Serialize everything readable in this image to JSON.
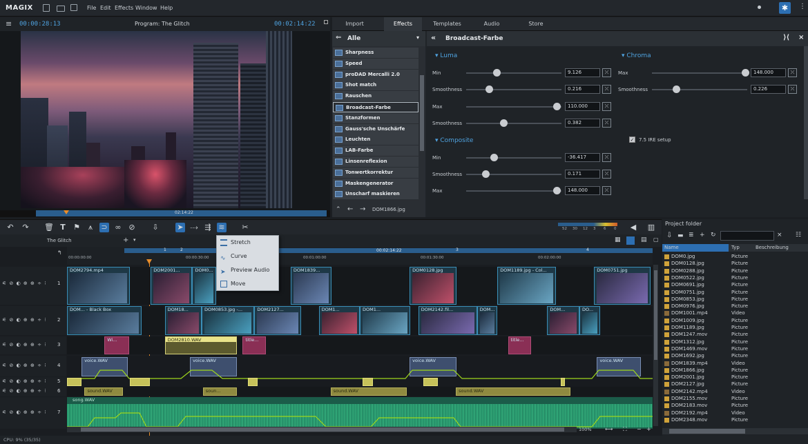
{
  "app": {
    "logo": "MAGIX",
    "menu": [
      "File",
      "Edit",
      "Effects",
      "Window",
      "Help"
    ]
  },
  "preview": {
    "timecode_left": "00:00:28:13",
    "title": "Program: The Glitch",
    "timecode_right": "00:02:14:22",
    "scrub_time": "02:14:22"
  },
  "tabs": [
    "Import",
    "Effects",
    "Templates",
    "Audio",
    "Store"
  ],
  "active_tab": "Effects",
  "fx": {
    "filter_label": "Alle",
    "items": [
      "Sharpness",
      "Speed",
      "proDAD Mercalli 2.0",
      "Shot match",
      "Rauschen",
      "Broadcast-Farbe",
      "Stanzformen",
      "Gauss'sche Unschärfe",
      "Leuchten",
      "LAB-Farbe",
      "Linsenreflexion",
      "Tonwertkorrektur",
      "Maskengenerator",
      "Unscharf maskieren"
    ],
    "selected": "Broadcast-Farbe",
    "footer_file": "DOM1866.jpg"
  },
  "params": {
    "title": "Broadcast-Farbe",
    "luma": {
      "label": "Luma",
      "rows": [
        {
          "name": "Min",
          "value": "9.126",
          "level": 0.32
        },
        {
          "name": "Smoothness",
          "value": "0.216",
          "level": 0.24
        },
        {
          "name": "Max",
          "value": "110.000",
          "level": 0.95
        },
        {
          "name": "Smoothness",
          "value": "0.382",
          "level": 0.39
        }
      ]
    },
    "composite": {
      "label": "Composite",
      "rows": [
        {
          "name": "Min",
          "value": "-36.417",
          "level": 0.29
        },
        {
          "name": "Smoothness",
          "value": "0.171",
          "level": 0.2
        },
        {
          "name": "Max",
          "value": "148.000",
          "level": 0.95
        }
      ]
    },
    "chroma": {
      "label": "Chroma",
      "rows": [
        {
          "name": "Max",
          "value": "148.000",
          "level": 0.98
        },
        {
          "name": "Smoothness",
          "value": "0.226",
          "level": 0.25
        }
      ]
    },
    "checkbox": "7.5 IRE setup",
    "reset_glyph": "⤫"
  },
  "timeline": {
    "tab": "The Glitch",
    "end_time": "00:02:14:22",
    "ruler_labels": [
      "00:00:00:00",
      "00:00:30:00",
      "00:01:00:00",
      "00:01:30:00",
      "00:02:00:00"
    ],
    "markers": [
      "1",
      "2",
      "3",
      "4"
    ],
    "track_numbers": [
      "1",
      "2",
      "3",
      "4",
      "5",
      "6",
      "7"
    ],
    "meter_labels": [
      "52",
      "30",
      "12",
      "3",
      "6",
      "0"
    ],
    "track1_clips": [
      {
        "label": "DOM2794.mp4",
        "start": 0.0,
        "end": 0.107
      },
      {
        "label": "DOM2001...",
        "start": 0.143,
        "end": 0.214
      },
      {
        "label": "DOM0...",
        "start": 0.214,
        "end": 0.255
      },
      {
        "label": "DOM1839...",
        "start": 0.382,
        "end": 0.452
      },
      {
        "label": "DOM0128.jpg",
        "start": 0.585,
        "end": 0.665
      },
      {
        "label": "DOM1189.jpg - Col...",
        "start": 0.735,
        "end": 0.835
      },
      {
        "label": "DOM0751.jpg",
        "start": 0.9,
        "end": 0.997
      }
    ],
    "track2_clips": [
      {
        "label": "DOM... - Black Box",
        "start": 0.0,
        "end": 0.127
      },
      {
        "label": "DOM18...",
        "start": 0.167,
        "end": 0.23
      },
      {
        "label": "DOM0853.jpg -...",
        "start": 0.23,
        "end": 0.32
      },
      {
        "label": "DOM2127...",
        "start": 0.32,
        "end": 0.4
      },
      {
        "label": "DOM1...",
        "start": 0.43,
        "end": 0.5
      },
      {
        "label": "DOM1...",
        "start": 0.5,
        "end": 0.586
      },
      {
        "label": "DOM2142.fil...",
        "start": 0.6,
        "end": 0.7
      },
      {
        "label": "DOM...",
        "start": 0.7,
        "end": 0.735
      },
      {
        "label": "DOM...",
        "start": 0.82,
        "end": 0.875
      },
      {
        "label": "DO...",
        "start": 0.875,
        "end": 0.91
      }
    ],
    "track3_clips": [
      {
        "label": "Wi...",
        "start": 0.064,
        "end": 0.106
      },
      {
        "label": "DOM2810.WAV",
        "start": 0.167,
        "end": 0.29
      },
      {
        "label": "title...",
        "start": 0.3,
        "end": 0.34
      },
      {
        "label": "title...",
        "start": 0.753,
        "end": 0.793
      }
    ],
    "voice_clips": [
      {
        "label": "voice.WAV",
        "start": 0.025,
        "end": 0.104
      },
      {
        "label": "voice.WAV",
        "start": 0.21,
        "end": 0.29
      },
      {
        "label": "voice.WAV",
        "start": 0.585,
        "end": 0.665
      },
      {
        "label": "voice.WAV",
        "start": 0.905,
        "end": 0.98
      }
    ],
    "sound_clips": [
      {
        "label": "sound.WAV",
        "start": 0.03,
        "end": 0.096
      },
      {
        "label": "soun...",
        "start": 0.232,
        "end": 0.29
      },
      {
        "label": "sound.WAV",
        "start": 0.45,
        "end": 0.58
      },
      {
        "label": "sound.WAV",
        "start": 0.664,
        "end": 0.86
      }
    ],
    "music_label": "song.WAV",
    "zoom": "100%"
  },
  "context_menu": [
    "Stretch",
    "Curve",
    "Preview Audio",
    "Move"
  ],
  "project_folder": {
    "title": "Project folder",
    "columns": [
      "Name",
      "Typ",
      "Beschreibung"
    ],
    "rows": [
      [
        "DOM0.jpg",
        "Picture"
      ],
      [
        "DOM0128.jpg",
        "Picture"
      ],
      [
        "DOM0288.jpg",
        "Picture"
      ],
      [
        "DOM0522.jpg",
        "Picture"
      ],
      [
        "DOM0691.jpg",
        "Picture"
      ],
      [
        "DOM0751.jpg",
        "Picture"
      ],
      [
        "DOM0853.jpg",
        "Picture"
      ],
      [
        "DOM0976.jpg",
        "Picture"
      ],
      [
        "DOM1001.mp4",
        "Video"
      ],
      [
        "DOM1009.jpg",
        "Picture"
      ],
      [
        "DOM1189.jpg",
        "Picture"
      ],
      [
        "DOM1247.mov",
        "Picture"
      ],
      [
        "DOM1312.jpg",
        "Picture"
      ],
      [
        "DOM1469.mov",
        "Picture"
      ],
      [
        "DOM1692.jpg",
        "Picture"
      ],
      [
        "DOM1839.mp4",
        "Video"
      ],
      [
        "DOM1866.jpg",
        "Picture"
      ],
      [
        "DOM2001.jpg",
        "Picture"
      ],
      [
        "DOM2127.jpg",
        "Picture"
      ],
      [
        "DOM2142.mp4",
        "Video"
      ],
      [
        "DOM2155.mov",
        "Picture"
      ],
      [
        "DOM2183.mov",
        "Picture"
      ],
      [
        "DOM2192.mp4",
        "Video"
      ],
      [
        "DOM2348.mov",
        "Picture"
      ]
    ]
  },
  "status": "CPU: 9% (35/35)",
  "colors": {
    "accent": "#2d6fb2",
    "timecode": "#4fa3e0",
    "video_clip_border": "#3a8fb8",
    "title_clip": "#8a2f55",
    "sound_clip": "#c6c25a",
    "music_wave": "#2fa97a",
    "curve": "#9ed61c"
  }
}
